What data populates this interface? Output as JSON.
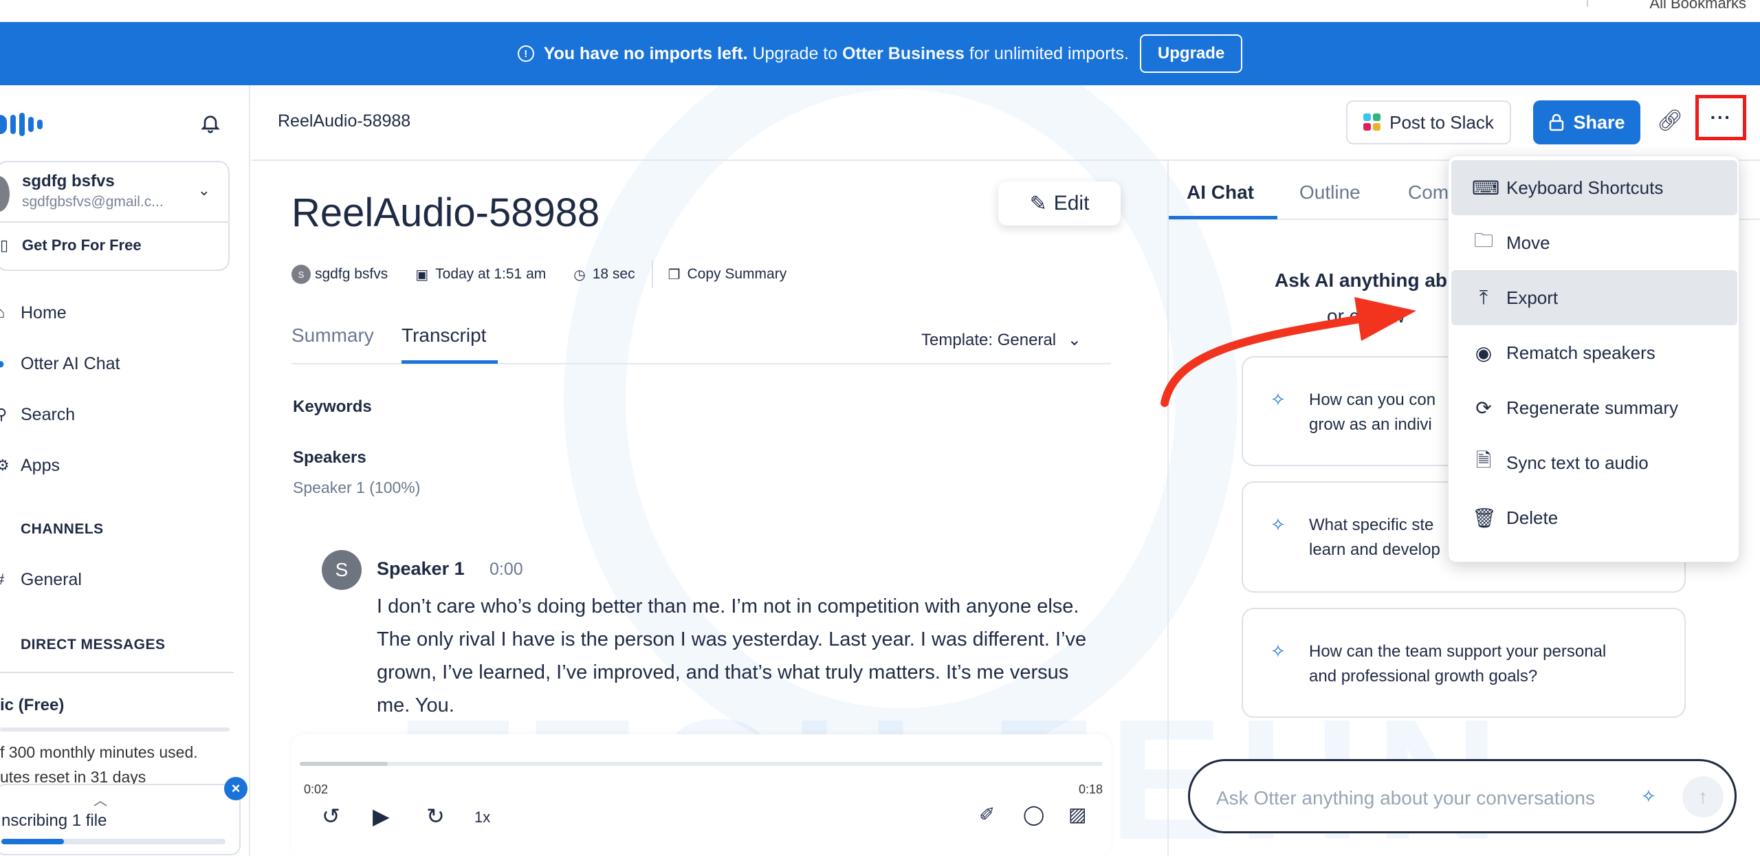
{
  "banner": {
    "bold": "You have no imports left.",
    "pre": " Upgrade to ",
    "brand": "Otter Business",
    "post": " for unlimited imports.",
    "upgrade_label": "Upgrade"
  },
  "sidebar": {
    "user_name": "sgdfg bsfvs",
    "user_email": "sgdfgbsfvs@gmail.c...",
    "get_pro": "Get Pro For Free",
    "nav": [
      {
        "label": "Home",
        "icon": "home-icon"
      },
      {
        "label": "Otter AI Chat",
        "icon": "globe-icon"
      },
      {
        "label": "Search",
        "icon": "search-icon"
      },
      {
        "label": "Apps",
        "icon": "apps-icon"
      }
    ],
    "channels_heading": "CHANNELS",
    "channel_general": "General",
    "dm_heading": "DIRECT MESSAGES",
    "plan": "ic (Free)",
    "usage_line1": "f 300 monthly minutes used.",
    "usage_line2": "utes reset in 31 days",
    "transcribing": "nscribing 1 file",
    "transcribe_progress": 0.28
  },
  "header": {
    "doc_title": "ReelAudio-58988",
    "post_to_slack": "Post to Slack",
    "share": "Share",
    "more": "···"
  },
  "main": {
    "title": "ReelAudio-58988",
    "edit": "Edit",
    "owner_initial": "S",
    "owner": "sgdfg bsfvs",
    "date": "Today at 1:51 am",
    "duration": "18 sec",
    "copy_summary": "Copy Summary",
    "tab_summary": "Summary",
    "tab_transcript": "Transcript",
    "template_label": "Template:",
    "template_value": "General",
    "keywords": "Keywords",
    "speakers_heading": "Speakers",
    "speakers_value": "Speaker 1 (100%)",
    "speaker_initial": "S",
    "speaker_name": "Speaker 1",
    "speaker_time": "0:00",
    "transcript": "I don’t care who’s doing better than me. I’m not in competition with anyone else. The only rival I have is the person I was yesterday. Last year. I was different. I’ve grown, I’ve learned, I’ve improved, and that’s what truly matters. It’s me versus me. You."
  },
  "player": {
    "current": "0:02",
    "total": "0:18",
    "speed": "1x",
    "progress": 0.11
  },
  "right": {
    "tab_chat": "AI Chat",
    "tab_outline": "Outline",
    "tab_comments": "Com",
    "ask_line1": "Ask AI anything ab",
    "ask_line2": "or chat w",
    "cards": [
      {
        "line1": "How can you con",
        "line2": "grow as an indivi"
      },
      {
        "line1": "What specific ste",
        "line2": "learn and develop"
      },
      {
        "line1": "How can the team support your personal",
        "line2": "and professional growth goals?"
      }
    ],
    "ask_placeholder": "Ask Otter anything about your conversations"
  },
  "menu": [
    {
      "label": "Keyboard Shortcuts",
      "icon": "keyboard-icon",
      "highlight": true
    },
    {
      "label": "Move",
      "icon": "folder-move-icon",
      "highlight": false
    },
    {
      "label": "Export",
      "icon": "export-icon",
      "highlight": true
    },
    {
      "label": "Rematch speakers",
      "icon": "rematch-icon",
      "highlight": false
    },
    {
      "label": "Regenerate summary",
      "icon": "refresh-icon",
      "highlight": false
    },
    {
      "label": "Sync text to audio",
      "icon": "sync-file-icon",
      "highlight": false
    },
    {
      "label": "Delete",
      "icon": "trash-icon",
      "highlight": false
    }
  ],
  "watermark": "TECH ZEHN",
  "top_bookmark": "All Bookmarks",
  "colors": {
    "primary": "#1a73d9",
    "highlight_box": "#ef1c1c",
    "arrow": "#f2341f",
    "text": "#1f2a44"
  }
}
